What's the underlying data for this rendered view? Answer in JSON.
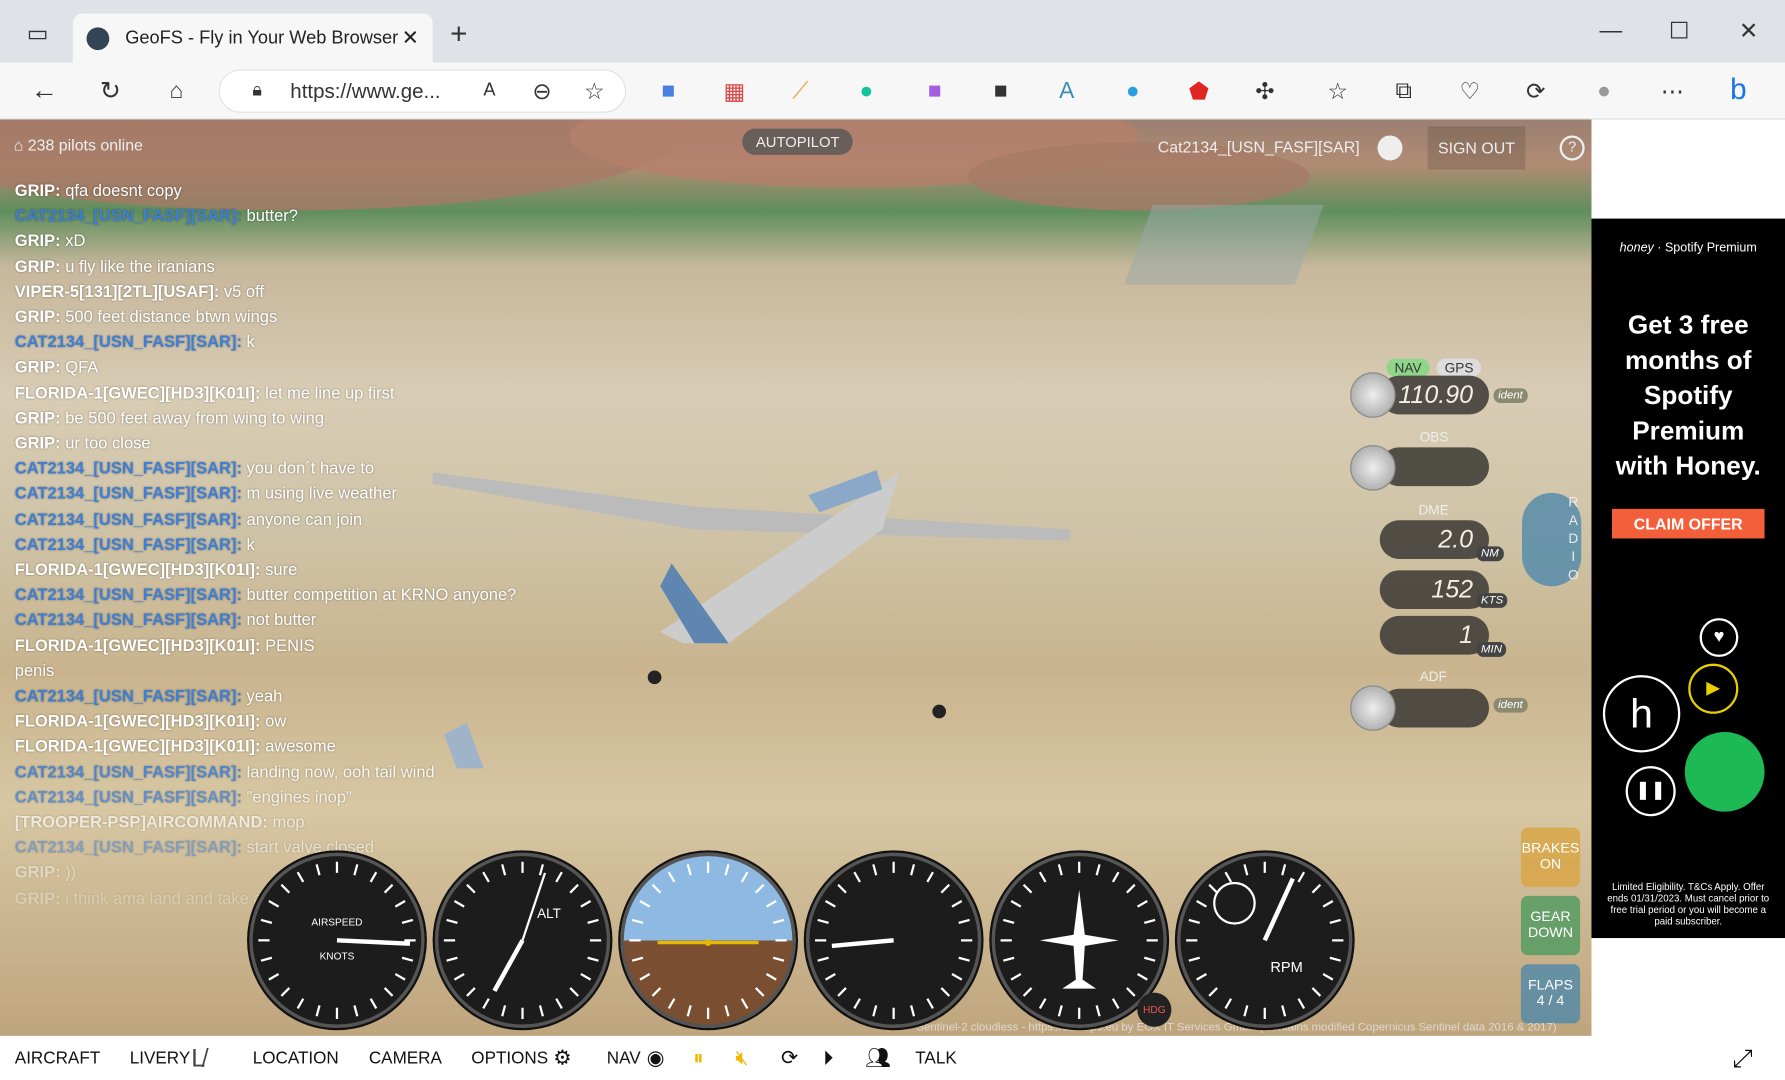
{
  "browser": {
    "tab_title": "GeoFS - Fly in Your Web Browser",
    "url": "https://www.ge..."
  },
  "hud": {
    "pilots_online": "238 pilots online",
    "autopilot": "AUTOPILOT",
    "username": "Cat2134_[USN_FASF][SAR]",
    "sign_out": "SIGN OUT",
    "help": "?"
  },
  "chat": [
    {
      "name": "GRIP:",
      "msg": "qfa doesnt copy",
      "cat": false
    },
    {
      "name": "CAT2134_[USN_FASF][SAR]:",
      "msg": "butter?",
      "cat": true
    },
    {
      "name": "GRIP:",
      "msg": "xD",
      "cat": false
    },
    {
      "name": "GRIP:",
      "msg": "u fly like the iranians",
      "cat": false
    },
    {
      "name": "VIPER-5[131][2TL][USAF]:",
      "msg": "v5 off",
      "cat": false
    },
    {
      "name": "GRIP:",
      "msg": "500 feet distance btwn wings",
      "cat": false
    },
    {
      "name": "CAT2134_[USN_FASF][SAR]:",
      "msg": "k",
      "cat": true
    },
    {
      "name": "GRIP:",
      "msg": "QFA",
      "cat": false
    },
    {
      "name": "FLORIDA-1[GWEC][HD3][K01I]:",
      "msg": "let me line up first",
      "cat": false
    },
    {
      "name": "GRIP:",
      "msg": "be 500 feet away from wing to wing",
      "cat": false
    },
    {
      "name": "GRIP:",
      "msg": "ur too close",
      "cat": false
    },
    {
      "name": "CAT2134_[USN_FASF][SAR]:",
      "msg": "you don´t have to",
      "cat": true
    },
    {
      "name": "CAT2134_[USN_FASF][SAR]:",
      "msg": "m using live weather",
      "cat": true
    },
    {
      "name": "CAT2134_[USN_FASF][SAR]:",
      "msg": "anyone can join",
      "cat": true
    },
    {
      "name": "CAT2134_[USN_FASF][SAR]:",
      "msg": "k",
      "cat": true
    },
    {
      "name": "FLORIDA-1[GWEC][HD3][K01I]:",
      "msg": "sure",
      "cat": false
    },
    {
      "name": "CAT2134_[USN_FASF][SAR]:",
      "msg": "butter competition at KRNO anyone?",
      "cat": true
    },
    {
      "name": "CAT2134_[USN_FASF][SAR]:",
      "msg": "not butter",
      "cat": true
    },
    {
      "name": "FLORIDA-1[GWEC][HD3][K01I]:",
      "msg": "PENIS",
      "cat": false
    },
    {
      "name": "",
      "msg": "penis",
      "cat": false
    },
    {
      "name": "CAT2134_[USN_FASF][SAR]:",
      "msg": "yeah",
      "cat": true
    },
    {
      "name": "FLORIDA-1[GWEC][HD3][K01I]:",
      "msg": "ow",
      "cat": false
    },
    {
      "name": "FLORIDA-1[GWEC][HD3][K01I]:",
      "msg": "awesome",
      "cat": false
    },
    {
      "name": "CAT2134_[USN_FASF][SAR]:",
      "msg": "landing now, ooh tail wind",
      "cat": true
    },
    {
      "name": "CAT2134_[USN_FASF][SAR]:",
      "msg": "\"engines inop\"",
      "cat": true
    },
    {
      "name": "[TROOPER-PSP]AIRCOMMAND:",
      "msg": "mop",
      "cat": false
    },
    {
      "name": "CAT2134_[USN_FASF][SAR]:",
      "msg": "start valve closed",
      "cat": true
    },
    {
      "name": "GRIP:",
      "msg": "))",
      "cat": false
    },
    {
      "name": "GRIP:",
      "msg": "i think ama land and take a taxi",
      "cat": false
    }
  ],
  "radio": {
    "nav": "NAV",
    "gps": "GPS",
    "freq": "110.90",
    "ident": "ident",
    "obs": "OBS",
    "dme": "DME",
    "dme_dist": "2.0",
    "dme_dist_unit": "NM",
    "dme_speed": "152",
    "dme_speed_unit": "KTS",
    "dme_time": "1",
    "dme_time_unit": "MIN",
    "adf": "ADF",
    "radio_tab": "RADIO"
  },
  "side_buttons": {
    "brakes": "BRAKES ON",
    "gear": "GEAR DOWN",
    "flaps": "FLAPS",
    "flaps_value": "4 / 4"
  },
  "gauges": {
    "airspeed_label": "AIRSPEED",
    "knots": "KNOTS",
    "alt_label": "ALT",
    "rpm": "RPM",
    "hdg": "HDG"
  },
  "attribution": "Sentinel-2 cloudless - https://s2maps.eu by EOX IT Services GmbH (Contains modified Copernicus Sentinel data 2016 & 2017)",
  "bottom_bar": {
    "aircraft": "AIRCRAFT",
    "livery": "LIVERY",
    "location": "LOCATION",
    "camera": "CAMERA",
    "options": "OPTIONS",
    "nav": "NAV",
    "talk": "TALK"
  },
  "ad": {
    "brand1": "honey",
    "brand2": "Spotify Premium",
    "headline": "Get 3 free months of Spotify Premium with Honey.",
    "cta": "CLAIM OFFER",
    "fine_print": "Limited Eligibility. T&Cs Apply. Offer ends 01/31/2023. Must cancel prior to free trial period or you will become a paid subscriber."
  }
}
